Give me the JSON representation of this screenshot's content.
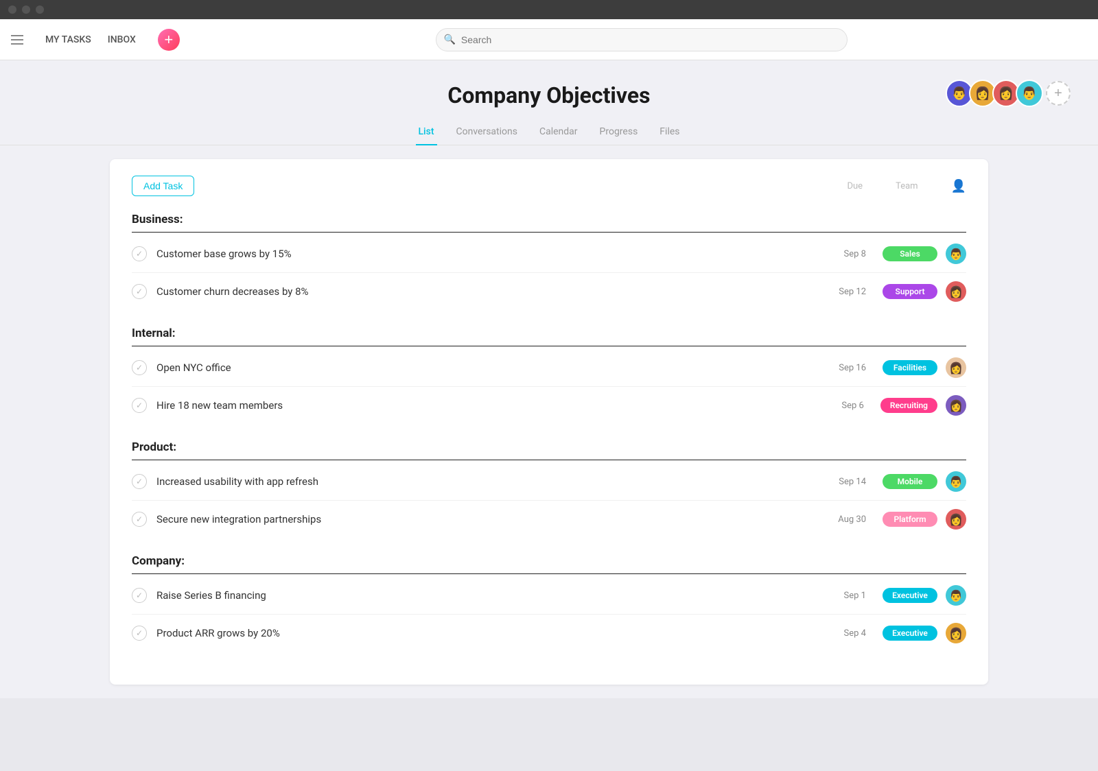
{
  "titlebar": {
    "dots": [
      "dot1",
      "dot2",
      "dot3"
    ]
  },
  "navbar": {
    "my_tasks": "MY TASKS",
    "inbox": "INBOX",
    "search_placeholder": "Search"
  },
  "header": {
    "title": "Company Objectives",
    "members": [
      {
        "color": "av1",
        "emoji": "👨"
      },
      {
        "color": "av2",
        "emoji": "👩"
      },
      {
        "color": "av3",
        "emoji": "👩"
      },
      {
        "color": "av4",
        "emoji": "👨"
      }
    ],
    "add_member_label": "+"
  },
  "tabs": [
    {
      "label": "List",
      "active": true
    },
    {
      "label": "Conversations",
      "active": false
    },
    {
      "label": "Calendar",
      "active": false
    },
    {
      "label": "Progress",
      "active": false
    },
    {
      "label": "Files",
      "active": false
    }
  ],
  "task_list": {
    "add_task_label": "Add Task",
    "col_due": "Due",
    "col_team": "Team",
    "sections": [
      {
        "title": "Business:",
        "tasks": [
          {
            "name": "Customer base grows by 15%",
            "due": "Sep 8",
            "team": "Sales",
            "badge_class": "badge-sales",
            "avatar_class": "ta1",
            "avatar_emoji": "👨"
          },
          {
            "name": "Customer churn decreases by 8%",
            "due": "Sep 12",
            "team": "Support",
            "badge_class": "badge-support",
            "avatar_class": "ta2",
            "avatar_emoji": "👩"
          }
        ]
      },
      {
        "title": "Internal:",
        "tasks": [
          {
            "name": "Open NYC office",
            "due": "Sep 16",
            "team": "Facilities",
            "badge_class": "badge-facilities",
            "avatar_class": "ta3",
            "avatar_emoji": "👩"
          },
          {
            "name": "Hire 18 new team members",
            "due": "Sep 6",
            "team": "Recruiting",
            "badge_class": "badge-recruiting",
            "avatar_class": "ta4",
            "avatar_emoji": "👩"
          }
        ]
      },
      {
        "title": "Product:",
        "tasks": [
          {
            "name": "Increased usability with app refresh",
            "due": "Sep 14",
            "team": "Mobile",
            "badge_class": "badge-mobile",
            "avatar_class": "ta5",
            "avatar_emoji": "👨"
          },
          {
            "name": "Secure new integration partnerships",
            "due": "Aug 30",
            "team": "Platform",
            "badge_class": "badge-platform",
            "avatar_class": "ta6",
            "avatar_emoji": "👩"
          }
        ]
      },
      {
        "title": "Company:",
        "tasks": [
          {
            "name": "Raise Series B financing",
            "due": "Sep 1",
            "team": "Executive",
            "badge_class": "badge-executive",
            "avatar_class": "ta7",
            "avatar_emoji": "👨"
          },
          {
            "name": "Product ARR grows by 20%",
            "due": "Sep 4",
            "team": "Executive",
            "badge_class": "badge-executive",
            "avatar_class": "ta8",
            "avatar_emoji": "👩"
          }
        ]
      }
    ]
  }
}
